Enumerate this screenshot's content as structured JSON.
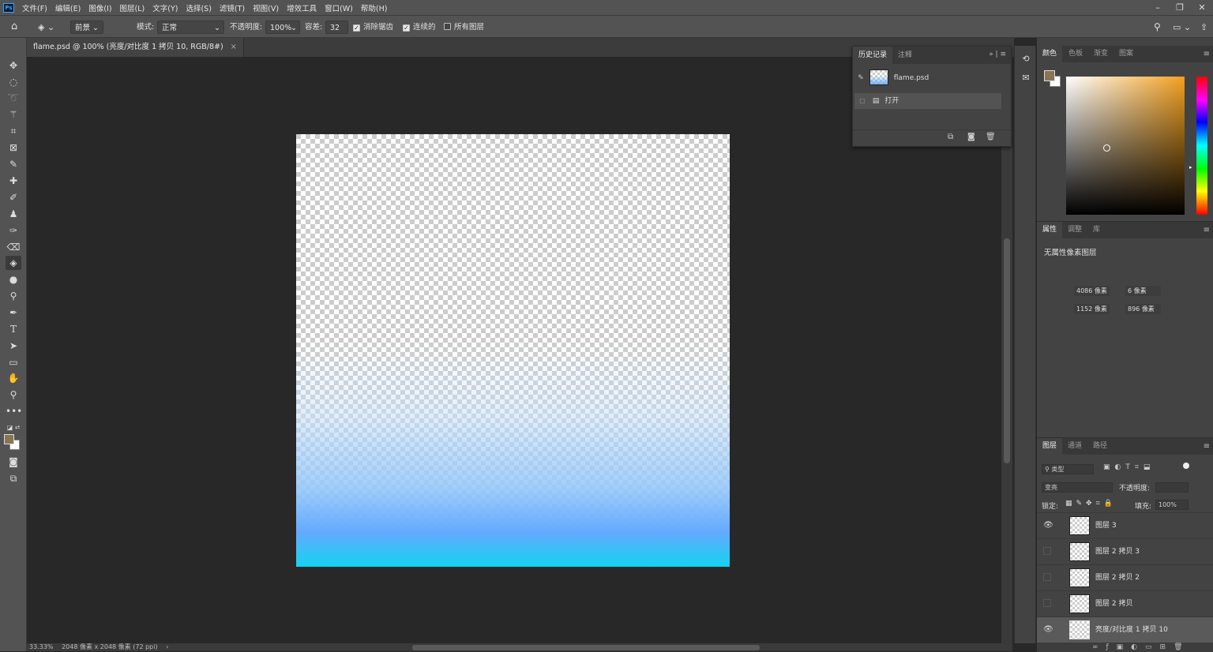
{
  "menubar": {
    "logo": "Ps",
    "items": [
      "文件(F)",
      "编辑(E)",
      "图像(I)",
      "图层(L)",
      "文字(Y)",
      "选择(S)",
      "滤镜(T)",
      "视图(V)",
      "增效工具",
      "窗口(W)",
      "帮助(H)"
    ],
    "controls": [
      "–",
      "❐",
      "✕"
    ]
  },
  "options": {
    "fill_source": "前景",
    "mode_label": "模式:",
    "mode_value": "正常",
    "opacity_label": "不透明度:",
    "opacity_value": "100%",
    "tolerance_label": "容差:",
    "tolerance_value": "32",
    "antialias_label": "消除锯齿",
    "antialias_checked": true,
    "contiguous_label": "连续的",
    "contiguous_checked": true,
    "all_layers_label": "所有图层",
    "all_layers_checked": false
  },
  "document": {
    "tab_title": "flame.psd @ 100% (亮度/对比度 1 拷贝 10, RGB/8#)",
    "tab_close": "×"
  },
  "status": {
    "zoom": "33.33%",
    "info": "2048 像素 x 2048 像素 (72 ppi)",
    "arrow": "›"
  },
  "history": {
    "tabs": [
      "历史记录",
      "注释"
    ],
    "items": [
      {
        "label": "flame.psd"
      },
      {
        "label": "打开"
      }
    ]
  },
  "color_panel": {
    "tabs": [
      "颜色",
      "色板",
      "渐变",
      "图案"
    ],
    "foreground": "#8a7552",
    "background": "#ffffff"
  },
  "properties": {
    "tabs": [
      "属性",
      "调整",
      "库"
    ],
    "title": "无属性像素图层",
    "w": "4086 像素",
    "h": "1152 像素",
    "x": "6 像素",
    "y": "896 像素"
  },
  "layers": {
    "tabs": [
      "图层",
      "通道",
      "路径"
    ],
    "filter_placeholder": "类型",
    "blend_mode": "变亮",
    "opacity_label": "不透明度:",
    "lock_label": "锁定:",
    "fill_label": "填充:",
    "fill_value": "100%",
    "items": [
      {
        "name": "图层 3",
        "visible": true
      },
      {
        "name": "图层 2 拷贝 3",
        "visible": false
      },
      {
        "name": "图层 2 拷贝 2",
        "visible": false
      },
      {
        "name": "图层 2 拷贝",
        "visible": false
      },
      {
        "name": "亮度/对比度 1 拷贝 10",
        "visible": true
      }
    ]
  }
}
